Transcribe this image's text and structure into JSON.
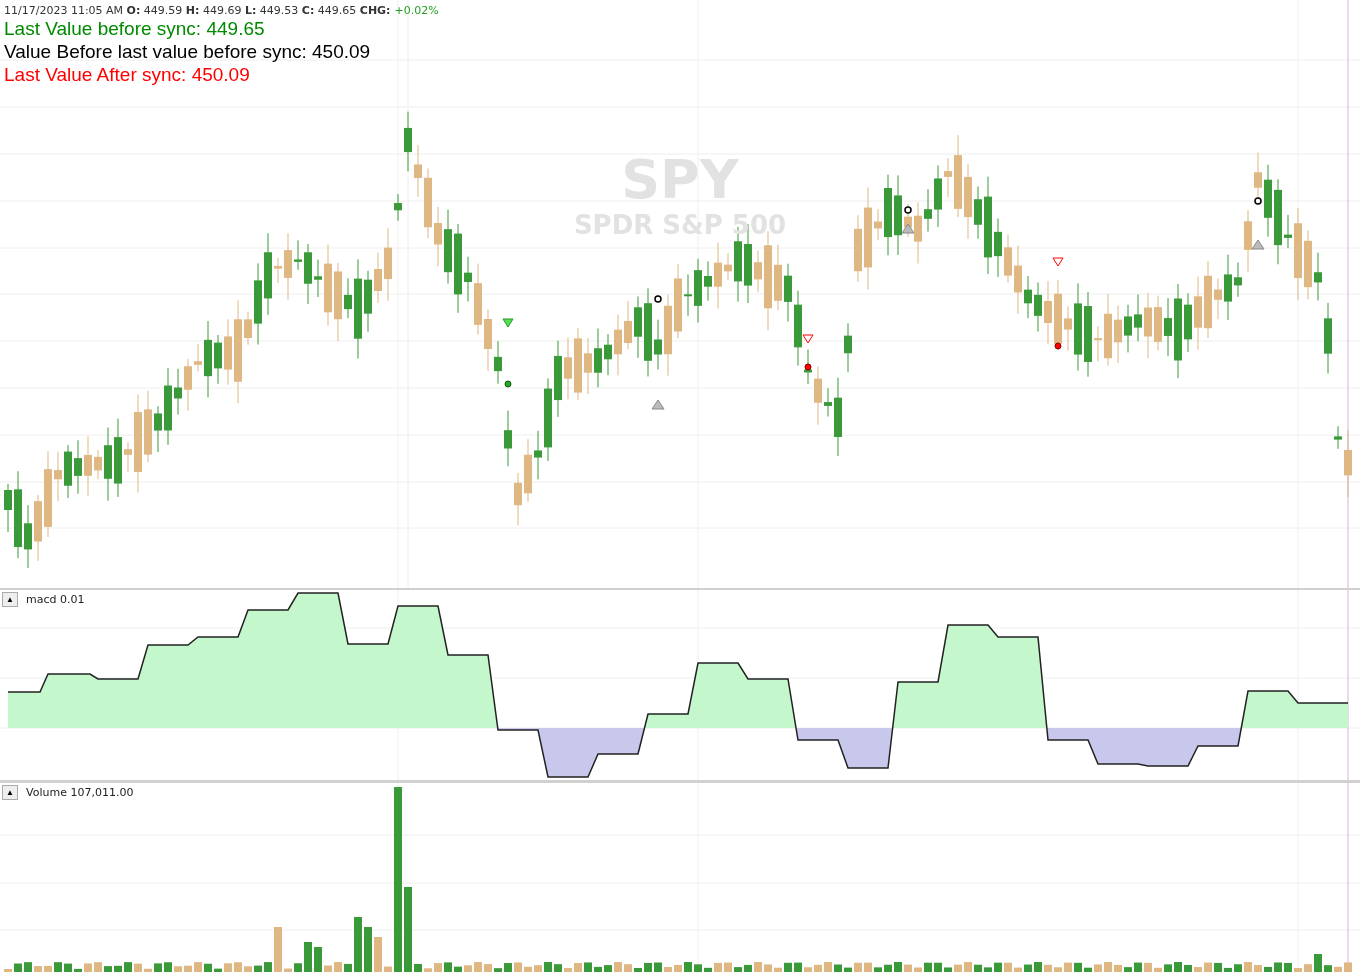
{
  "header": {
    "readout": "11/17/2023 11:05 AM **O:** 449.59 **H:** 449.69 **L:** 449.53 **C:** 449.65 **CHG:**",
    "change": "+0.02%"
  },
  "sync_lines": [
    {
      "text": "Last Value before sync: 449.65",
      "color": "#008a00"
    },
    {
      "text": "Value Before last value before sync: 450.09",
      "color": "#000000"
    },
    {
      "text": "Last Value After sync: 450.09",
      "color": "#ff0000"
    }
  ],
  "watermark": {
    "symbol": "SPY",
    "name": "SPDR S&P 500"
  },
  "panels": [
    {
      "collapse_button": "▲",
      "label": "macd 0.01"
    },
    {
      "collapse_button": "▲",
      "label": "Volume 107,011.00"
    }
  ]
}
